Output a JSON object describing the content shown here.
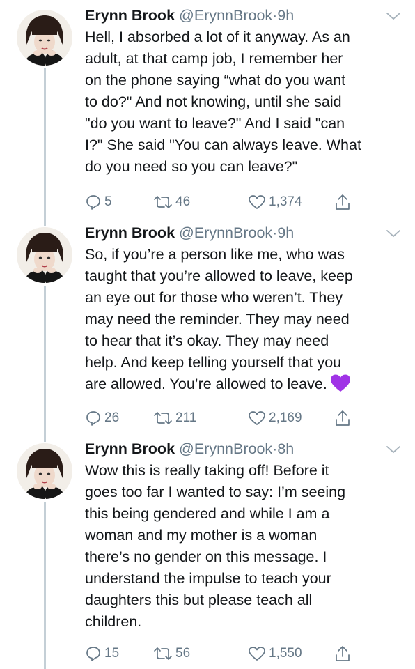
{
  "tweets": [
    {
      "name": "Erynn Brook",
      "handle": "@ErynnBrook",
      "separator": "·",
      "time": "9h",
      "text": "Hell, I absorbed a lot of it anyway. As an\nadult, at that camp job, I remember her\non the phone saying “what do you want\nto do?\" And not knowing, until she said\n\"do you want to leave?\" And I said \"can\nI?\" She said \"You can always leave. What\ndo you need so you can leave?\"",
      "emoji": "",
      "replies": "5",
      "retweets": "46",
      "likes": "1,374"
    },
    {
      "name": "Erynn Brook",
      "handle": "@ErynnBrook",
      "separator": "·",
      "time": "9h",
      "text": "So, if you’re a person like me, who was\ntaught that you’re allowed to leave, keep\nan eye out for those who weren’t. They\nmay need the reminder. They may need\nto hear that it’s okay. They may need\nhelp. And keep telling yourself that you\nare allowed. You’re allowed to leave.",
      "emoji": "purple-heart",
      "replies": "26",
      "retweets": "211",
      "likes": "2,169"
    },
    {
      "name": "Erynn Brook",
      "handle": "@ErynnBrook",
      "separator": "·",
      "time": "8h",
      "text": "Wow this is really taking off! Before it\ngoes too far I wanted to say: I’m seeing\nthis being gendered and while I am a\nwoman and my mother is a woman\nthere’s no gender on this message. I\nunderstand the impulse to teach your\ndaughters this but please teach all\nchildren.",
      "emoji": "",
      "replies": "15",
      "retweets": "56",
      "likes": "1,550"
    }
  ],
  "colors": {
    "text": "#14171a",
    "muted": "#657786",
    "thread_line": "#c4cfd6",
    "emoji_purple": "#a033e6"
  },
  "icons": {
    "reply": "reply-icon",
    "retweet": "retweet-icon",
    "like": "heart-icon",
    "share": "share-icon",
    "menu": "chevron-down-icon"
  }
}
